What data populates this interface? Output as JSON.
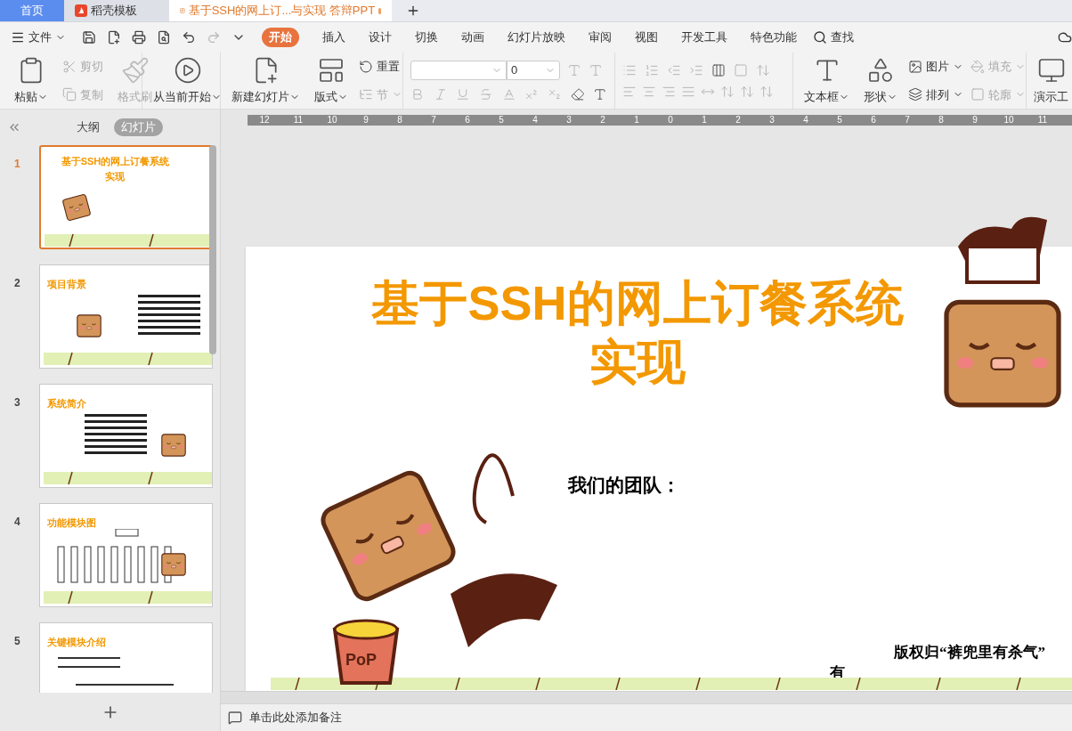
{
  "doc_tabs": [
    {
      "label": "首页",
      "kind": "home",
      "selected": false
    },
    {
      "label": "稻壳模板",
      "kind": "docer",
      "selected": false
    },
    {
      "label": "基于SSH的网上订...与实现 答辩PPT",
      "kind": "doc",
      "selected": true,
      "modified": true
    }
  ],
  "menu": {
    "file": "文件",
    "ribbon_tabs": [
      {
        "label": "开始",
        "selected": true
      },
      {
        "label": "插入",
        "selected": false
      },
      {
        "label": "设计",
        "selected": false
      },
      {
        "label": "切换",
        "selected": false
      },
      {
        "label": "动画",
        "selected": false
      },
      {
        "label": "幻灯片放映",
        "selected": false
      },
      {
        "label": "审阅",
        "selected": false
      },
      {
        "label": "视图",
        "selected": false
      },
      {
        "label": "开发工具",
        "selected": false
      },
      {
        "label": "特色功能",
        "selected": false
      }
    ],
    "search": "查找"
  },
  "ribbon": {
    "paste": {
      "label": "粘贴",
      "disabled": false,
      "dropdown": true
    },
    "clipboard": [
      {
        "label": "剪切",
        "disabled": true
      },
      {
        "label": "复制",
        "disabled": true
      }
    ],
    "format_painter": {
      "label": "格式刷",
      "disabled": true
    },
    "play": {
      "label": "从当前开始",
      "disabled": false,
      "dropdown": true
    },
    "new_slide": {
      "label": "新建幻灯片",
      "disabled": false,
      "dropdown": true
    },
    "layout": {
      "label": "版式",
      "disabled": false,
      "dropdown": true
    },
    "slide_tools": [
      {
        "label": "重置",
        "disabled": false,
        "dropdown": false
      },
      {
        "label": "节",
        "disabled": true,
        "dropdown": true
      }
    ],
    "font_size": "0",
    "textbox": {
      "label": "文本框",
      "disabled": false,
      "dropdown": true
    },
    "shape": {
      "label": "形状",
      "disabled": false,
      "dropdown": true
    },
    "draw_tools": [
      {
        "label": "图片",
        "disabled": false,
        "dropdown": true
      },
      {
        "label": "填充",
        "disabled": true,
        "dropdown": true
      },
      {
        "label": "排列",
        "disabled": false,
        "dropdown": true
      },
      {
        "label": "轮廓",
        "disabled": true,
        "dropdown": true
      }
    ],
    "presenter": {
      "label": "演示工"
    }
  },
  "ruler": [
    "12",
    "11",
    "10",
    "9",
    "8",
    "7",
    "6",
    "5",
    "4",
    "3",
    "2",
    "1",
    "0",
    "1",
    "2",
    "3",
    "4",
    "5",
    "6",
    "7",
    "8",
    "9",
    "10",
    "11"
  ],
  "panel": {
    "tabs": [
      {
        "label": "大纲",
        "selected": false
      },
      {
        "label": "幻灯片",
        "selected": true
      }
    ],
    "slides": [
      {
        "number": "1",
        "title": "基于SSH的网上订餐系统",
        "subtitle": "实现",
        "kind": "cover",
        "selected": true
      },
      {
        "number": "2",
        "title": "项目背景",
        "kind": "text",
        "selected": false
      },
      {
        "number": "3",
        "title": "系统简介",
        "kind": "text",
        "selected": false
      },
      {
        "number": "4",
        "title": "功能模块图",
        "kind": "chart",
        "selected": false
      },
      {
        "number": "5",
        "title": "关键模块介绍",
        "kind": "code",
        "selected": false
      }
    ]
  },
  "slide": {
    "title": "基于SSH的网上订餐系统",
    "title_line2": "实现",
    "team_label": "我们的团队：",
    "copyright": "版权归“裤兜里有杀气”",
    "copyright_wrap": "有",
    "bucket_label": "PoP"
  },
  "notes": {
    "placeholder": "单击此处添加备注"
  }
}
